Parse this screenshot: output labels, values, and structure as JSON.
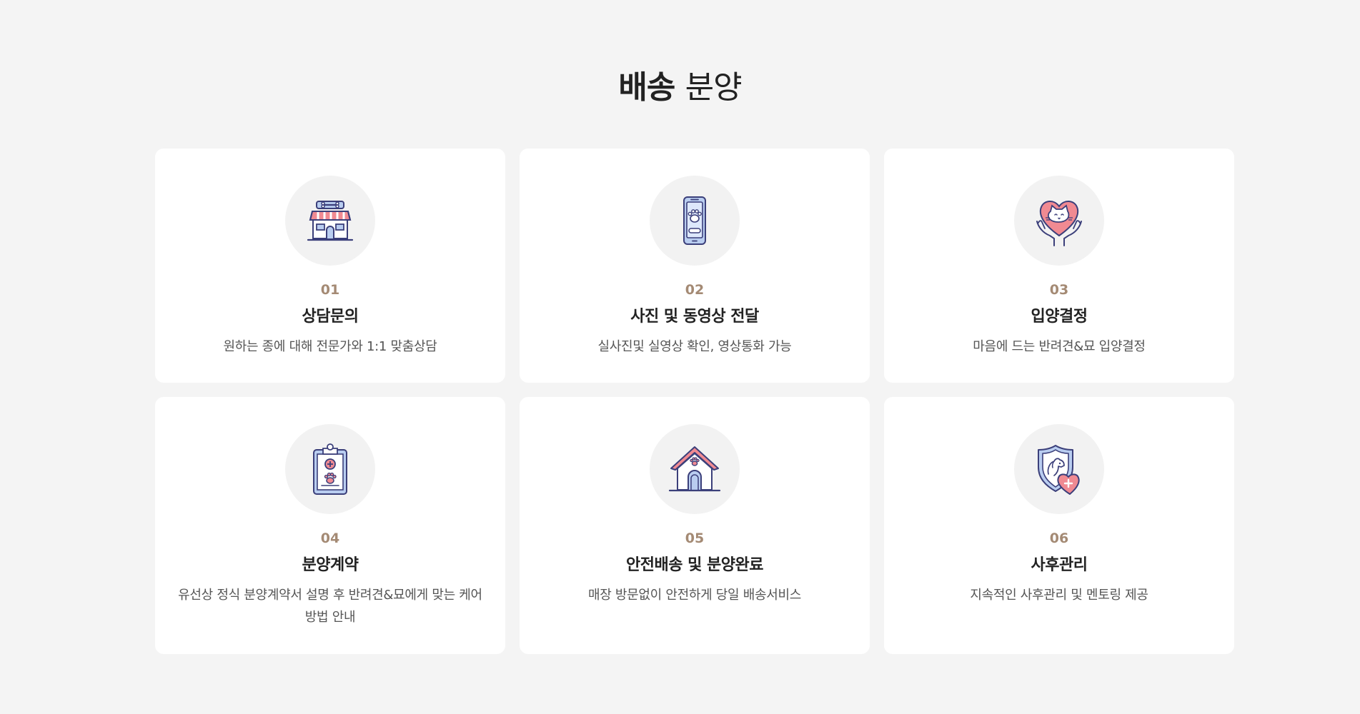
{
  "section": {
    "title_bold": "배송",
    "title_light": "분양"
  },
  "steps": [
    {
      "num": "01",
      "title": "상담문의",
      "desc": "원하는 종에 대해 전문가와 1:1 맞춤상담",
      "icon": "pet-shop-icon"
    },
    {
      "num": "02",
      "title": "사진 및 동영상 전달",
      "desc": "실사진및 실영상 확인, 영상통화 가능",
      "icon": "phone-paw-icon"
    },
    {
      "num": "03",
      "title": "입양결정",
      "desc": "마음에 드는 반려견&묘 입양결정",
      "icon": "cat-heart-hands-icon"
    },
    {
      "num": "04",
      "title": "분양계약",
      "desc": "유선상 정식 분양계약서 설명 후 반려견&묘에게 맞는 케어 방법 안내",
      "icon": "clipboard-paw-icon"
    },
    {
      "num": "05",
      "title": "안전배송 및 분양완료",
      "desc": "매장 방문없이 안전하게 당일 배송서비스",
      "icon": "dog-house-icon"
    },
    {
      "num": "06",
      "title": "사후관리",
      "desc": "지속적인 사후관리 및 멘토링 제공",
      "icon": "shield-dog-icon"
    }
  ],
  "colors": {
    "background": "#f4f4f4",
    "card": "#ffffff",
    "number": "#a48a74",
    "icon_outline": "#3b3f7a",
    "icon_pink": "#f08a92",
    "icon_blue": "#b9cdf0"
  }
}
